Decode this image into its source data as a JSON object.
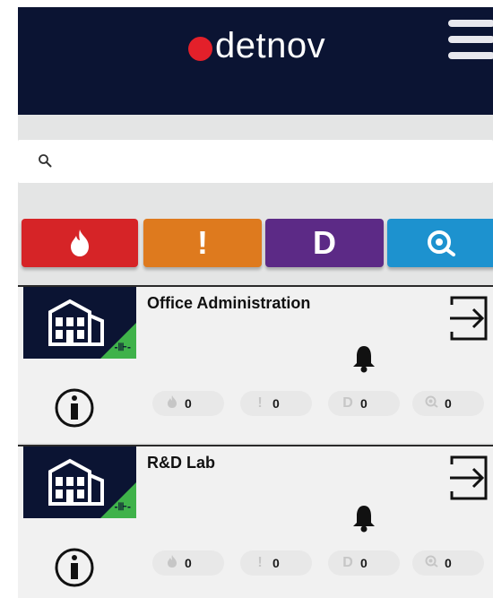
{
  "header": {
    "brand": "detnov",
    "brand_color": "#e3202a",
    "background": "#0b1433",
    "menu_icon": "hamburger-menu-icon"
  },
  "search": {
    "placeholder": "",
    "value": "",
    "icon": "search-icon"
  },
  "filters": [
    {
      "name": "fire",
      "icon": "flame-icon",
      "color": "#d62427"
    },
    {
      "name": "fault",
      "icon": "exclamation-icon",
      "glyph": "!",
      "color": "#de7a1e"
    },
    {
      "name": "disabled",
      "icon": "letter-d-icon",
      "glyph": "D",
      "color": "#5c2a86"
    },
    {
      "name": "alarm",
      "icon": "siren-icon",
      "color": "#1d92cf"
    }
  ],
  "installations": [
    {
      "title": "Office Administration",
      "connected": true,
      "counters": {
        "fire": "0",
        "fault": "0",
        "disabled": "0",
        "alarm": "0"
      }
    },
    {
      "title": "R&D Lab",
      "connected": true,
      "counters": {
        "fire": "0",
        "fault": "0",
        "disabled": "0",
        "alarm": "0"
      }
    }
  ]
}
